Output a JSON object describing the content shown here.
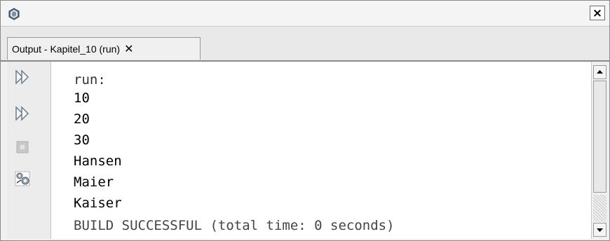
{
  "window": {
    "close_label": "×"
  },
  "tab": {
    "label": "Output - Kapitel_10 (run)",
    "close": "✕"
  },
  "toolbar": {
    "items": [
      {
        "icon": "rerun-icon"
      },
      {
        "icon": "rerun-with-options-icon"
      },
      {
        "icon": "stop-icon"
      },
      {
        "icon": "output-settings-icon"
      }
    ]
  },
  "output": {
    "lines": [
      {
        "text": "run:",
        "color": "#333333"
      },
      {
        "text": "10",
        "color": "#000000"
      },
      {
        "text": "20",
        "color": "#000000"
      },
      {
        "text": "30",
        "color": "#000000"
      },
      {
        "text": "Hansen",
        "color": "#000000"
      },
      {
        "text": "Maier",
        "color": "#000000"
      },
      {
        "text": "Kaiser",
        "color": "#000000"
      },
      {
        "text": "BUILD SUCCESSFUL (total time: 0 seconds)",
        "color": "#444444"
      }
    ]
  }
}
